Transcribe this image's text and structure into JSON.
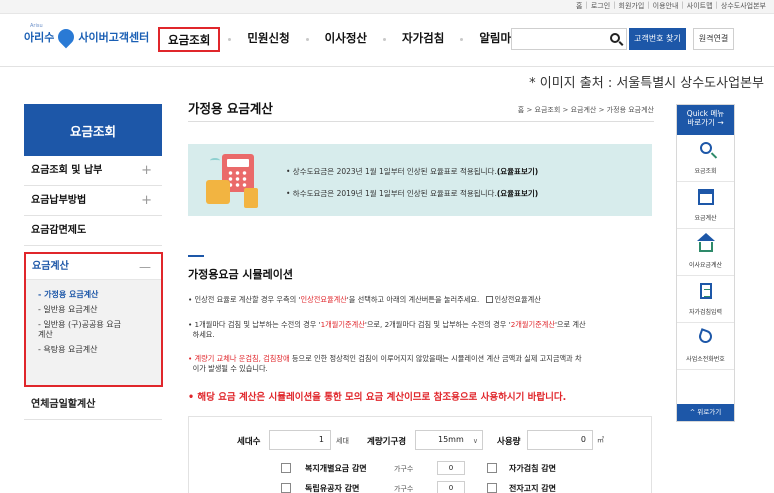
{
  "util_links": [
    "홈",
    "로그인",
    "회원가입",
    "이용안내",
    "사이트맵",
    "상수도사업본부"
  ],
  "logo": {
    "arisu": "아리수",
    "arisu_en": "Arisu",
    "center": "사이버고객센터"
  },
  "gnb": [
    "요금조회",
    "민원신청",
    "이사정산",
    "자가검침",
    "알림마당"
  ],
  "gnb_active_index": 0,
  "search": {
    "find_label": "고객번호 찾기",
    "remote_label": "원격연결"
  },
  "source_caption": "* 이미지 출처 : 서울특별시 상수도사업본부",
  "lnb": {
    "title": "요금조회",
    "items": [
      {
        "label": "요금조회 및 납부",
        "toggle": "+"
      },
      {
        "label": "요금납부방법",
        "toggle": "+"
      },
      {
        "label": "요금감면제도",
        "toggle": ""
      }
    ],
    "group": {
      "label": "요금계산",
      "toggle": "—",
      "subs": [
        "- 가정용 요금계산",
        "- 일반용 요금계산",
        "- 일반용 (구)공공용 요금계산",
        "- 욕탕용 요금계산"
      ]
    },
    "last": "연체금일할계산"
  },
  "page": {
    "title": "가정용 요금계산",
    "breadcrumb": "홈 > 요금조회 > 요금계산 > 가정용 요금계산"
  },
  "notice": {
    "line1": "• 상수도요금은 2023년 1월 1일부터 인상된 요율표로 적용됩니다.",
    "line1_link": "(요율표보기)",
    "line2": "• 하수도요금은 2019년 1월 1일부터 인상된 요율표로 적용됩니다.",
    "line2_link": "(요율표보기)"
  },
  "simulation": {
    "title": "가정용요금 시뮬레이션",
    "p1_a": "• 인상전 요율로 계산할 경우 우측의 '",
    "p1_red": "인상전요율계산",
    "p1_b": "'을 선택하고 아래의 계산버튼을 눌러주세요.",
    "p1_check": "인상전요율계산",
    "p2_a": "• 1개월마다 검침 및 납부하는 수전의 경우 '",
    "p2_red1": "1개월기준계산",
    "p2_b": "'으로, 2개월마다 검침 및 납부하는 수전의 경우 '",
    "p2_red2": "2개월기준계산",
    "p2_c": "'으로 계산",
    "p2_d": "하세요.",
    "p3_red": "• 계량기 교체나 운검침, 검침장애",
    "p3_a": " 등으로 인한 정상적인 검침이 이루어지지 않았을때는 시뮬레이션 계산 금액과 실제 고지금액과 차",
    "p3_b": "이가 발생될 수 있습니다.",
    "warning": "• 해당 요금 계산은 시뮬레이션을 통한 모의 요금 계산이므로 참조용으로 사용하시기 바랍니다."
  },
  "form": {
    "households_label": "세대수",
    "households_value": "1",
    "households_unit": "세대",
    "meter_label": "계량기구경",
    "meter_value": "15mm",
    "usage_label": "사용량",
    "usage_value": "0",
    "usage_unit": "㎥",
    "opt1_label": "복지개별요금 감면",
    "opt1_sub": "가구수",
    "opt1_value": "0",
    "opt2_label": "자가검침 감면",
    "opt3_label": "독립유공자 감면",
    "opt3_sub": "가구수",
    "opt3_value": "0",
    "opt4_label": "전자고지 감면"
  },
  "quick": {
    "title1": "Quick 메뉴",
    "title2": "바로가기 →",
    "items": [
      "요금조회",
      "요금계산",
      "이사요금계산",
      "자가검침입력",
      "사업소전화번호"
    ],
    "foot": "^ 위로가기"
  }
}
